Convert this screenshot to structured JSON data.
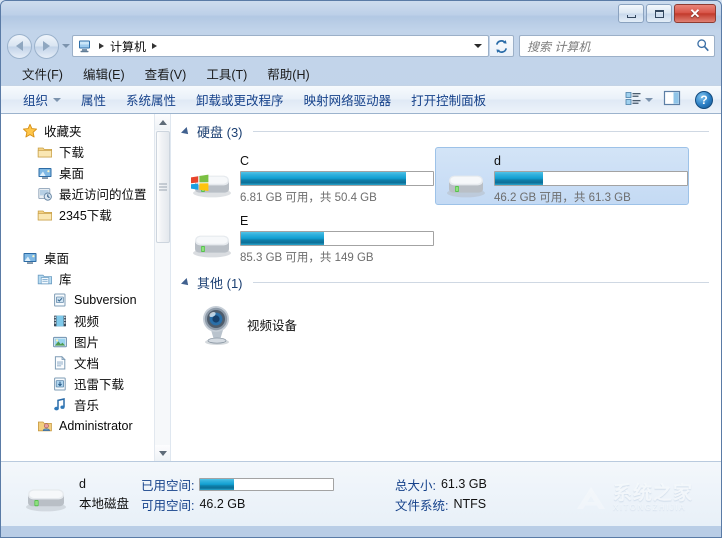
{
  "window": {
    "controls": {
      "minimize": "",
      "maximize": "",
      "close": "✕"
    }
  },
  "address": {
    "breadcrumb_icon": "computer-icon",
    "breadcrumb": "计算机",
    "back_tooltip": "后退",
    "forward_tooltip": "前进"
  },
  "search": {
    "placeholder": "搜索 计算机",
    "icon": "search-icon"
  },
  "menu": {
    "items": [
      {
        "label": "文件(F)",
        "name": "menu-file"
      },
      {
        "label": "编辑(E)",
        "name": "menu-edit"
      },
      {
        "label": "查看(V)",
        "name": "menu-view"
      },
      {
        "label": "工具(T)",
        "name": "menu-tools"
      },
      {
        "label": "帮助(H)",
        "name": "menu-help"
      }
    ]
  },
  "toolbar": {
    "organize": "组织",
    "items": [
      {
        "label": "属性",
        "name": "toolbar-properties"
      },
      {
        "label": "系统属性",
        "name": "toolbar-system-properties"
      },
      {
        "label": "卸载或更改程序",
        "name": "toolbar-uninstall-change-program"
      },
      {
        "label": "映射网络驱动器",
        "name": "toolbar-map-network-drive"
      },
      {
        "label": "打开控制面板",
        "name": "toolbar-open-control-panel"
      }
    ],
    "view_icon": "view-options-icon",
    "preview_icon": "preview-pane-icon",
    "help_label": "?"
  },
  "sidebar": {
    "items": [
      {
        "label": "收藏夹",
        "icon": "star-icon",
        "level": 0,
        "name": "sidebar-item-favorites"
      },
      {
        "label": "下载",
        "icon": "folder-icon",
        "level": 1,
        "name": "sidebar-item-downloads"
      },
      {
        "label": "桌面",
        "icon": "desktop-icon",
        "level": 1,
        "name": "sidebar-item-desktop-fav"
      },
      {
        "label": "最近访问的位置",
        "icon": "recent-places-icon",
        "level": 1,
        "name": "sidebar-item-recent-places"
      },
      {
        "label": "2345下载",
        "icon": "folder-icon",
        "level": 1,
        "name": "sidebar-item-2345-downloads"
      },
      {
        "label": "",
        "icon": "spacer",
        "level": 0,
        "name": "sidebar-spacer"
      },
      {
        "label": "桌面",
        "icon": "desktop-icon",
        "level": 0,
        "name": "sidebar-item-desktop"
      },
      {
        "label": "库",
        "icon": "library-icon",
        "level": 1,
        "name": "sidebar-item-libraries"
      },
      {
        "label": "Subversion",
        "icon": "subversion-icon",
        "level": 2,
        "name": "sidebar-item-subversion"
      },
      {
        "label": "视频",
        "icon": "video-icon",
        "level": 2,
        "name": "sidebar-item-videos"
      },
      {
        "label": "图片",
        "icon": "pictures-icon",
        "level": 2,
        "name": "sidebar-item-pictures"
      },
      {
        "label": "文档",
        "icon": "documents-icon",
        "level": 2,
        "name": "sidebar-item-documents"
      },
      {
        "label": "迅雷下载",
        "icon": "thunder-download-icon",
        "level": 2,
        "name": "sidebar-item-thunder-download"
      },
      {
        "label": "音乐",
        "icon": "music-icon",
        "level": 2,
        "name": "sidebar-item-music"
      },
      {
        "label": "Administrator",
        "icon": "user-icon",
        "level": 1,
        "name": "sidebar-item-administrator"
      }
    ]
  },
  "content": {
    "groups": [
      {
        "title": "硬盘 (3)",
        "name": "group-hard-disk-drives"
      },
      {
        "title": "其他 (1)",
        "name": "group-other"
      }
    ],
    "drives": [
      {
        "name": "C",
        "info": "6.81 GB 可用，共 50.4 GB",
        "free": "6.81 GB",
        "total": "50.4 GB",
        "used_percent": 86,
        "selected": false,
        "system": true,
        "icon": "hard-drive-windows-icon"
      },
      {
        "name": "d",
        "info": "46.2 GB 可用，共 61.3 GB",
        "free": "46.2 GB",
        "total": "61.3 GB",
        "used_percent": 25,
        "selected": true,
        "system": false,
        "icon": "hard-drive-icon"
      },
      {
        "name": "E",
        "info": "85.3 GB 可用，共 149 GB",
        "free": "85.3 GB",
        "total": "149 GB",
        "used_percent": 43,
        "selected": false,
        "system": false,
        "icon": "hard-drive-icon"
      }
    ],
    "others": [
      {
        "label": "视频设备",
        "icon": "webcam-icon",
        "name": "device-video-device"
      }
    ]
  },
  "status": {
    "icon": "hard-drive-icon",
    "name": "d",
    "type": "本地磁盘",
    "used_label": "已用空间:",
    "free_label": "可用空间:",
    "free_value": "46.2 GB",
    "total_label": "总大小:",
    "total_value": "61.3 GB",
    "fs_label": "文件系统:",
    "fs_value": "NTFS",
    "used_percent": 25
  },
  "watermark": {
    "text": "系统之家",
    "subtext": "XITONGZHIJIA"
  },
  "colors": {
    "accent": "#15418a",
    "group_title": "#1b3f72",
    "bar_fill": "#12a0d2",
    "selection": "#c4daf4",
    "close_button": "#c23a2c"
  }
}
